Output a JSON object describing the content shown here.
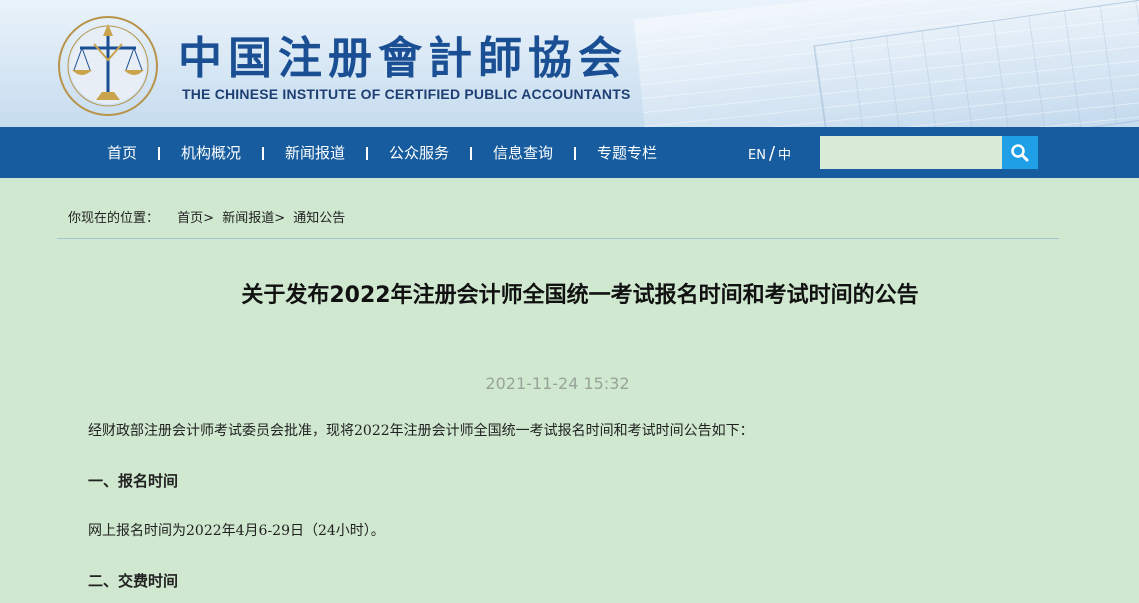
{
  "header": {
    "brand_cn": "中国注册會計師協会",
    "brand_en": "THE CHINESE INSTITUTE OF CERTIFIED PUBLIC ACCOUNTANTS",
    "logo_icon": "cicpa-scales-logo-icon"
  },
  "nav": {
    "items": [
      "首页",
      "机构概况",
      "新闻报道",
      "公众服务",
      "信息查询",
      "专题专栏"
    ],
    "lang_en": "EN",
    "lang_sep": "/",
    "lang_cn": "中"
  },
  "search": {
    "value": "",
    "placeholder": "",
    "icon": "search-icon",
    "button_color": "#1f9fe6"
  },
  "breadcrumb": {
    "lead": "你现在的位置：",
    "items": [
      "首页>",
      "新闻报道>",
      "通知公告"
    ]
  },
  "article": {
    "title": "关于发布2022年注册会计师全国统一考试报名时间和考试时间的公告",
    "date": "2021-11-24 15:32",
    "intro": "经财政部注册会计师考试委员会批准，现将2022年注册会计师全国统一考试报名时间和考试时间公告如下：",
    "section1_heading": "一、报名时间",
    "section1_text": "网上报名时间为2022年4月6-29日（24小时）。",
    "section2_heading": "二、交费时间"
  },
  "colors": {
    "page_bg": "#cfe8cf",
    "nav_bg": "#175c9e",
    "brand_blue": "#1a4f94"
  }
}
